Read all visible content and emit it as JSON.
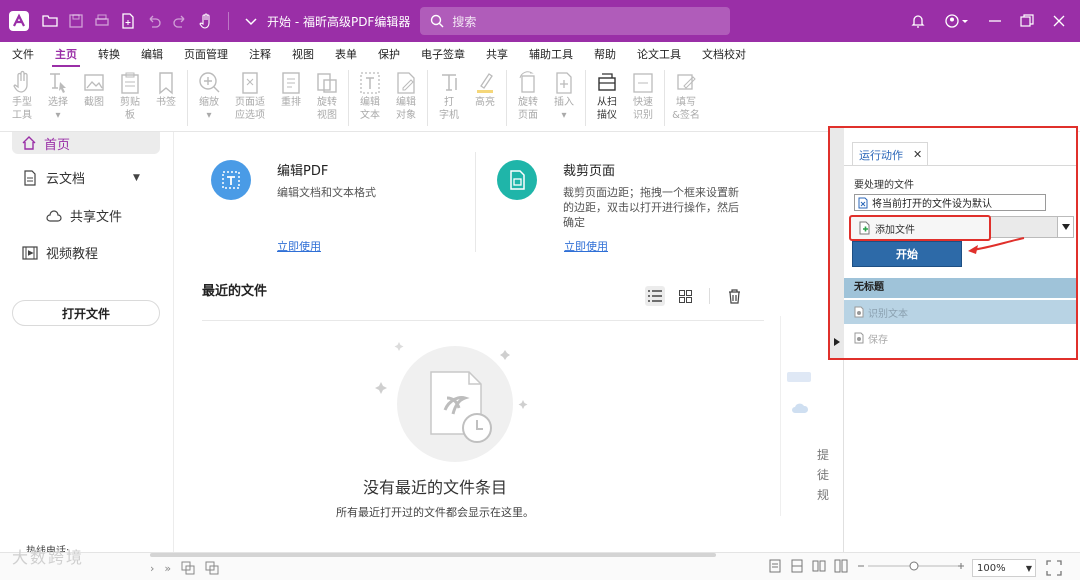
{
  "titlebar": {
    "title": "开始 - 福昕高级PDF编辑器",
    "search_placeholder": "搜索",
    "brand_color": "#9a2fa7"
  },
  "menu": {
    "tabs": [
      "文件",
      "主页",
      "转换",
      "编辑",
      "页面管理",
      "注释",
      "视图",
      "表单",
      "保护",
      "电子签章",
      "共享",
      "辅助工具",
      "帮助",
      "论文工具",
      "文档校对"
    ],
    "active": "主页"
  },
  "ribbon": {
    "buttons": [
      {
        "label1": "手型",
        "label2": "工具",
        "icon": "hand-icon"
      },
      {
        "label1": "选择",
        "label2": "",
        "icon": "select-icon"
      },
      {
        "label1": "截图",
        "label2": "",
        "icon": "screenshot-icon"
      },
      {
        "label1": "剪贴",
        "label2": "板",
        "icon": "clipboard-icon"
      },
      {
        "label1": "书签",
        "label2": "",
        "icon": "bookmark-icon"
      },
      {
        "label1": "缩放",
        "label2": "",
        "icon": "zoom-icon"
      },
      {
        "label1": "页面适",
        "label2": "应选项",
        "icon": "fit-page-icon"
      },
      {
        "label1": "重排",
        "label2": "",
        "icon": "reflow-icon"
      },
      {
        "label1": "旋转",
        "label2": "视图",
        "icon": "rotate-view-icon"
      },
      {
        "label1": "编辑",
        "label2": "文本",
        "icon": "edit-text-icon"
      },
      {
        "label1": "编辑",
        "label2": "对象",
        "icon": "edit-object-icon"
      },
      {
        "label1": "打",
        "label2": "字机",
        "icon": "typewriter-icon"
      },
      {
        "label1": "高亮",
        "label2": "",
        "icon": "highlight-icon"
      },
      {
        "label1": "旋转",
        "label2": "页面",
        "icon": "rotate-page-icon"
      },
      {
        "label1": "插入",
        "label2": "",
        "icon": "insert-icon"
      },
      {
        "label1": "从扫",
        "label2": "描仪",
        "icon": "scanner-icon"
      },
      {
        "label1": "快速",
        "label2": "识别",
        "icon": "ocr-icon"
      },
      {
        "label1": "填写",
        "label2": "&签名",
        "icon": "fill-sign-icon"
      }
    ]
  },
  "sidebar": {
    "home": "首页",
    "cloud": "云文档",
    "shared": "共享文件",
    "video": "视频教程",
    "open_file": "打开文件",
    "bottom_text": "热线电话:"
  },
  "cards": [
    {
      "title": "编辑PDF",
      "desc": "编辑文档和文本格式",
      "link": "立即使用",
      "color": "#4a9be6"
    },
    {
      "title": "裁剪页面",
      "desc": "裁剪页面边距；拖拽一个框来设置新的边距，双击以打开进行操作，然后确定",
      "link": "立即使用",
      "color": "#1fb5a9"
    }
  ],
  "recent": {
    "title": "最近的文件",
    "empty_title": "没有最近的文件条目",
    "empty_sub": "所有最近打开过的文件都会显示在这里。"
  },
  "side_preview": {
    "chars": [
      "提",
      "徒",
      "规"
    ]
  },
  "run_panel": {
    "tab": "运行动作",
    "files_label": "要处理的文件",
    "current_file": "将当前打开的文件设为默认",
    "add_file": "添加文件",
    "start": "开始",
    "section": "无标题",
    "rows": [
      "识别文本",
      "保存"
    ],
    "highlight_color": "#e0302b",
    "start_color": "#2d6aa8"
  },
  "statusbar": {
    "zoom": "100%"
  },
  "watermark": "大数跨境"
}
